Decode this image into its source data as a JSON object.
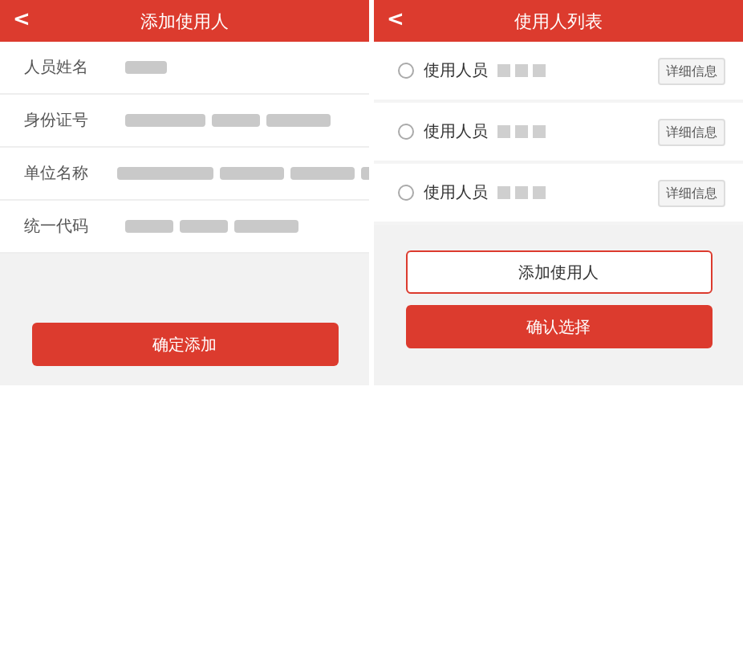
{
  "add_screen": {
    "title": "添加使用人",
    "back": "<",
    "fields": [
      {
        "label": "人员姓名"
      },
      {
        "label": "身份证号"
      },
      {
        "label": "单位名称"
      },
      {
        "label": "统一代码"
      }
    ],
    "submit": "确定添加"
  },
  "list_screen": {
    "title": "使用人列表",
    "back": "<",
    "users": [
      {
        "label": "使用人员",
        "selected": false,
        "details": "详细信息"
      },
      {
        "label": "使用人员",
        "selected": false,
        "details": "详细信息"
      },
      {
        "label": "使用人员",
        "selected": false,
        "details": "详细信息"
      }
    ],
    "add_button": "添加使用人",
    "confirm_button": "确认选择"
  }
}
